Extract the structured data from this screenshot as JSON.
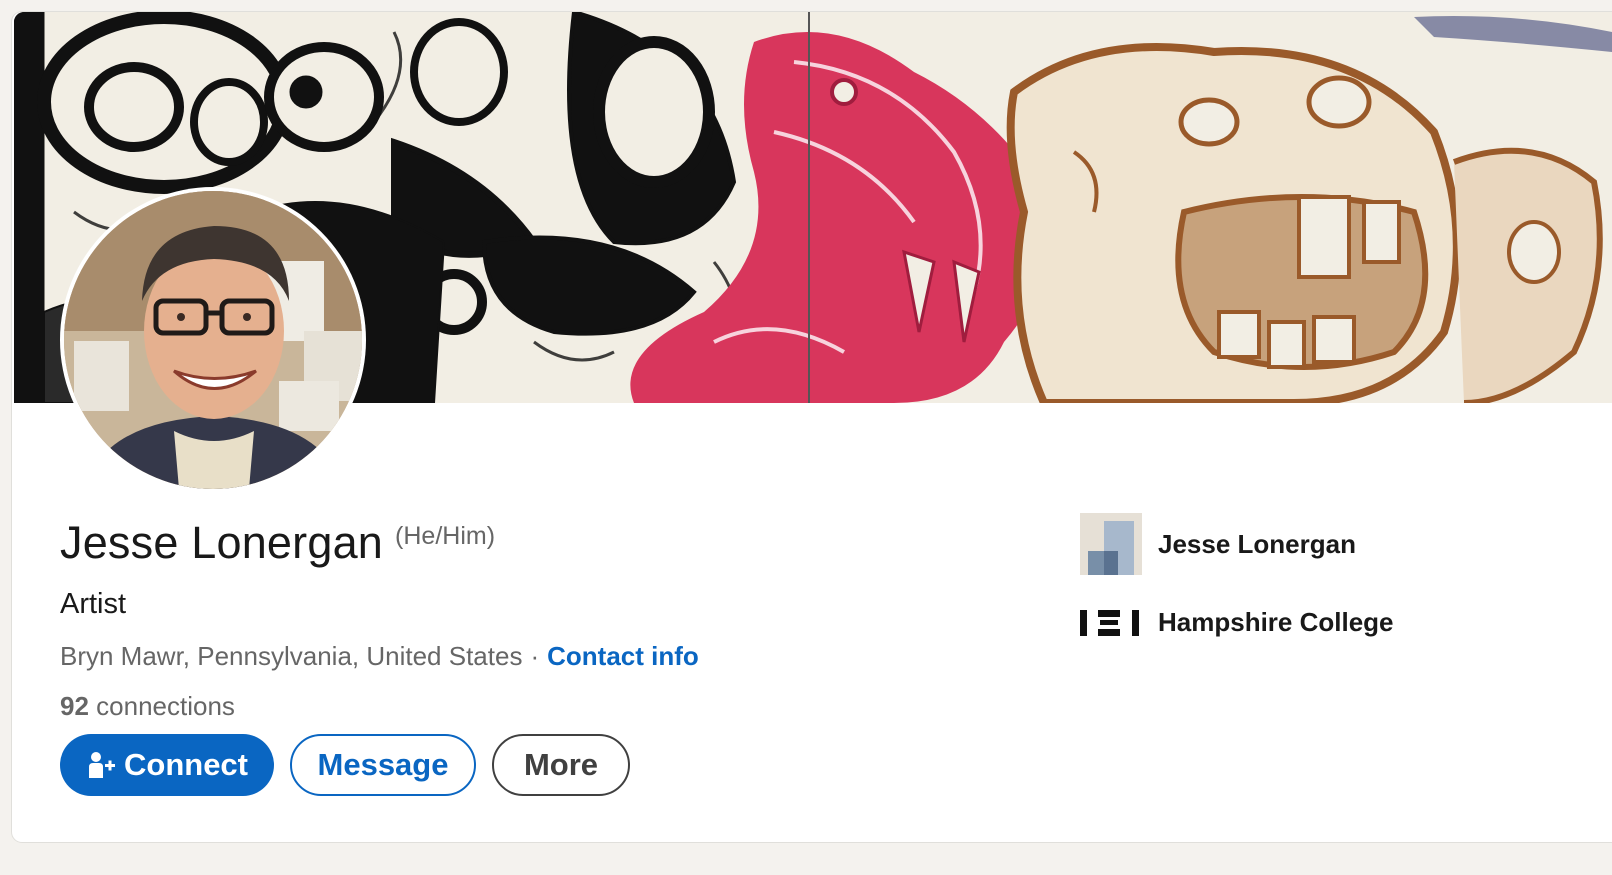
{
  "profile": {
    "name": "Jesse Lonergan",
    "pronouns": "(He/Him)",
    "headline": "Artist",
    "location": "Bryn Mawr, Pennsylvania, United States",
    "separator": "·",
    "contact_info_label": "Contact info",
    "connections_count": "92",
    "connections_label": "connections"
  },
  "actions": {
    "connect_label": "Connect",
    "message_label": "Message",
    "more_label": "More"
  },
  "organizations": [
    {
      "name": "Jesse Lonergan",
      "logo": "company-placeholder-icon"
    },
    {
      "name": "Hampshire College",
      "logo": "hampshire-college-logo"
    }
  ],
  "colors": {
    "brand_blue": "#0a66c2",
    "cover_red": "#d8365c",
    "cover_brown": "#9a5a2a",
    "cover_black": "#111111"
  }
}
